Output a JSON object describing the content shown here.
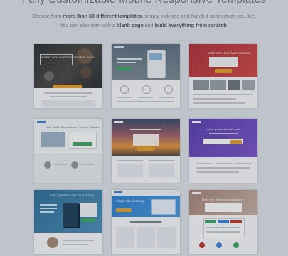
{
  "header": {
    "title": "Fully Customizable Mobile Responsive Templates",
    "line1_a": "Choose from ",
    "line1_b": "more than 80 different templates",
    "line1_c": ", simply pick one and tweak it as much as you like.",
    "line2_a": "You can also start with a ",
    "line2_b": "blank page",
    "line2_c": " and ",
    "line2_d": "build everything from scratch",
    "line2_e": "."
  },
  "templates": [
    {
      "headline": "A NEXT GEN EXPERIENCE OF FLAVOR"
    },
    {
      "headline": ""
    },
    {
      "headline": "Make Your Next Event Awesome"
    },
    {
      "headline": "How To Get Great Leads For Your Website"
    },
    {
      "headline": ""
    },
    {
      "headline": "Lorem ipsum dolor sit amet"
    },
    {
      "headline": "THE ULTIMATE GUIDE TO SUCCESS"
    },
    {
      "headline": "Simple Cloud Hosting"
    },
    {
      "headline": "Make Your Next Event Awesome"
    }
  ],
  "colors": {
    "background": "#e1e4ea",
    "accent_orange": "#e8a028",
    "accent_green": "#3aa860",
    "accent_blue": "#3d7fd6",
    "purple": "#6a4bbf",
    "red": "#c0392b"
  }
}
